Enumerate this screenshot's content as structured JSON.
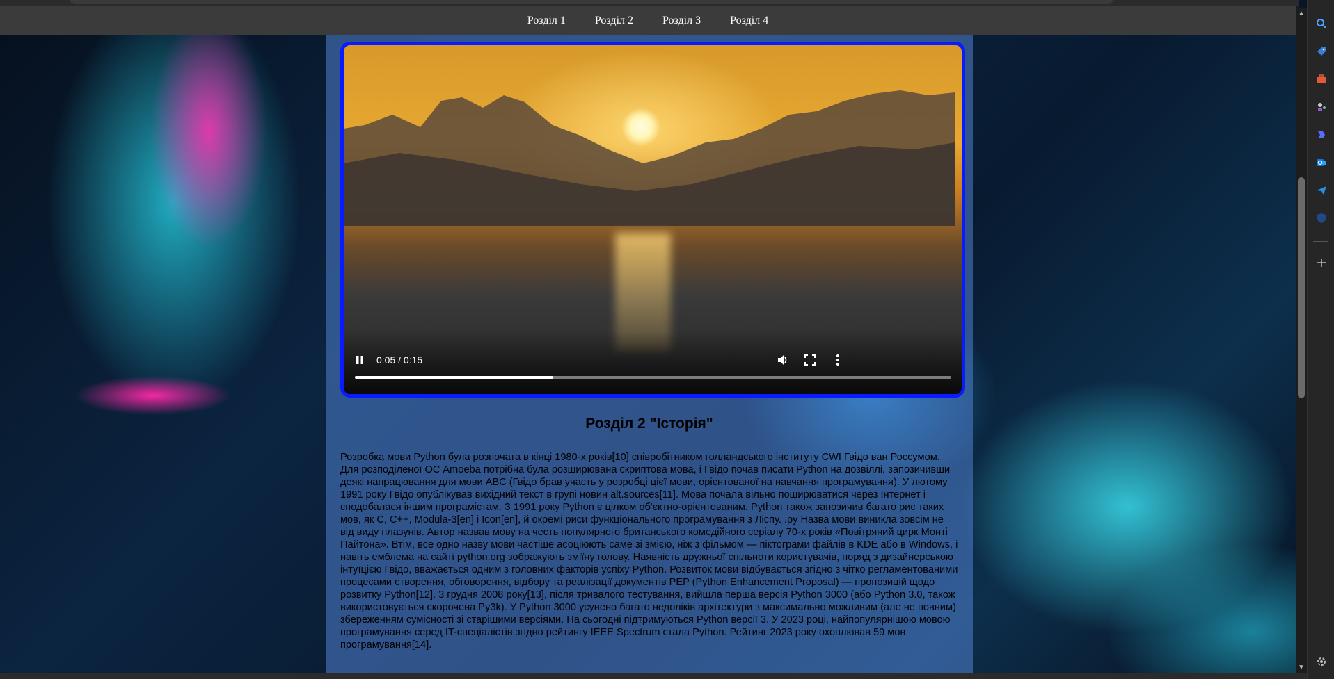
{
  "nav": {
    "items": [
      {
        "label": "Розділ 1"
      },
      {
        "label": "Розділ 2"
      },
      {
        "label": "Розділ 3"
      },
      {
        "label": "Розділ 4"
      }
    ]
  },
  "video": {
    "time_display": "0:05 / 0:15",
    "progress_fraction": 0.333,
    "controls": [
      "pause-icon",
      "volume-icon",
      "fullscreen-icon",
      "more-options-icon"
    ]
  },
  "section": {
    "title": "Розділ 2 \"Історія\"",
    "text": "Розробка мови Python була розпочата в кінці 1980-х років[10] співробітником голландського інституту CWI Гвідо ван Россумом. Для розподіленої ОС Amoeba потрібна була розширювана скриптова мова, і Гвідо почав писати Python на дозвіллі, запозичивши деякі напрацювання для мови ABC (Гвідо брав участь у розробці цієї мови, орієнтованої на навчання програмування). У лютому 1991 року Гвідо опублікував вихідний текст в групі новин alt.sources[11]. Мова почала вільно поширюватися через Інтернет і сподобалася іншим програмістам. З 1991 року Python є цілком об'єктно-орієнтованим. Python також запозичив багато рис таких мов, як C, C++, Modula-3[en] і Icon[en], й окремі риси функціонального програмування з Ліспу. .py Назва мови виникла зовсім не від виду плазунів. Автор назвав мову на честь популярного британського комедійного серіалу 70-х років «Повітряний цирк Монті Пайтона». Втім, все одно назву мови частіше асоціюють саме зі змією, ніж з фільмом — піктограми файлів в KDE або в Windows, і навіть емблема на сайті python.org зображують зміїну голову. Наявність дружньої спільноти користувачів, поряд з дизайнерською інтуїцією Гвідо, вважається одним з головних факторів успіху Python. Розвиток мови відбувається згідно з чітко регламентованими процесами створення, обговорення, відбору та реалізації документів PEP (Python Enhancement Proposal) — пропозицій щодо розвитку Python[12]. 3 грудня 2008 року[13], після тривалого тестування, вийшла перша версія Python 3000 (або Python 3.0, також використовується скорочена Py3k). У Python 3000 усунено багато недоліків архітектури з максимально можливим (але не повним) збереженням сумісності зі старішими версіями. На сьогодні підтримуються Python версії 3. У 2023 році, найпопулярнішою мовою програмування серед IT-спеціалістів згідно рейтингу IEEE Spectrum стала Python. Рейтинг 2023 року охоплював 59 мов програмування[14]."
  },
  "colors": {
    "video_border": "#0a1cff",
    "navbar_bg": "#3b3b3b",
    "content_overlay": "rgba(80,130,210,0.55)"
  },
  "browser_sidebar": {
    "icons": [
      "search-icon",
      "tag-icon",
      "toolbox-icon",
      "chess-icon",
      "copilot-icon",
      "outlook-icon",
      "send-icon",
      "shield-icon",
      "add-icon",
      "settings-icon"
    ]
  }
}
